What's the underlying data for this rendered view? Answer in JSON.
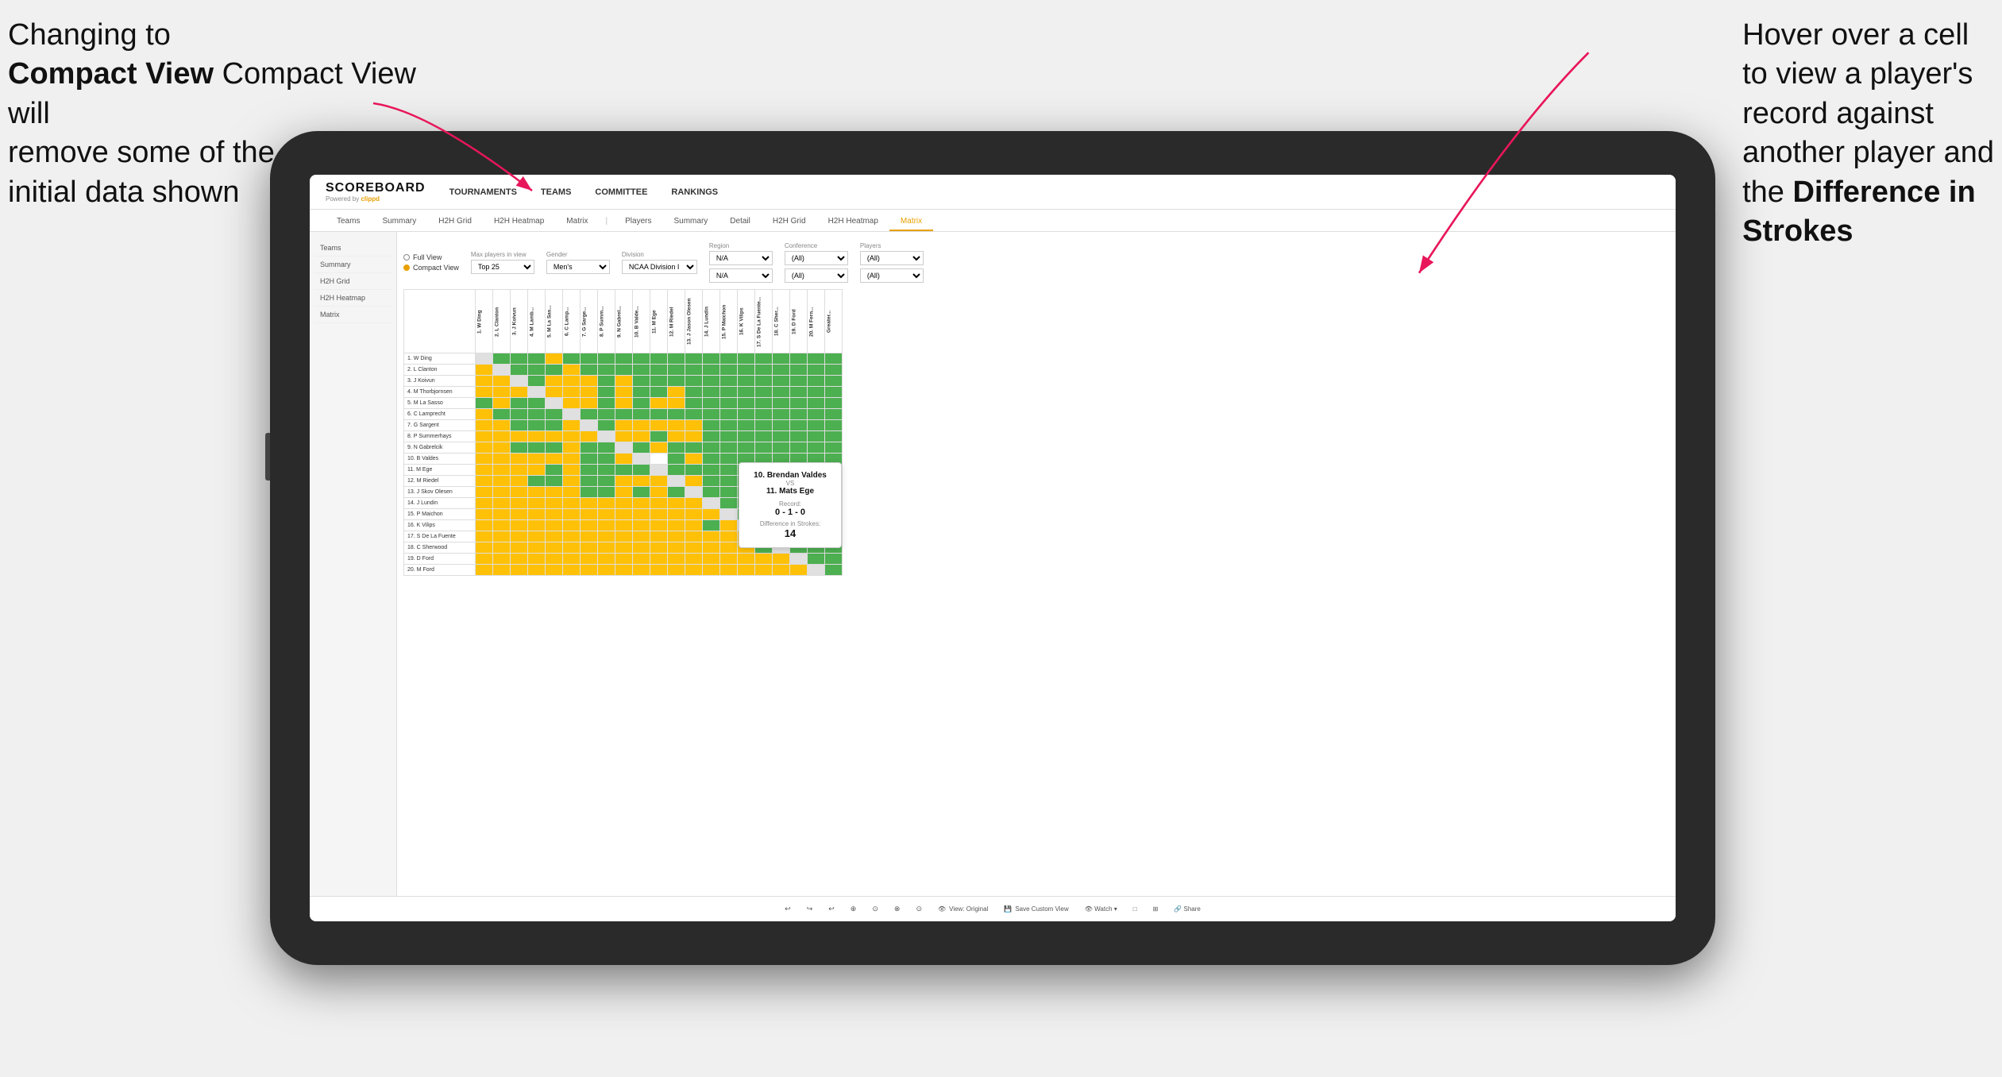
{
  "annotations": {
    "left": {
      "line1": "Changing to",
      "line2": "Compact View will",
      "line3": "remove some of the",
      "line4": "initial data shown"
    },
    "right": {
      "line1": "Hover over a cell",
      "line2": "to view a player's",
      "line3": "record against",
      "line4": "another player and",
      "line5": "the",
      "line6": "Difference in",
      "line7": "Strokes"
    }
  },
  "nav": {
    "logo": "SCOREBOARD",
    "powered_by": "Powered by",
    "clippd": "clippd",
    "links": [
      "TOURNAMENTS",
      "TEAMS",
      "COMMITTEE",
      "RANKINGS"
    ]
  },
  "sub_tabs": [
    "Teams",
    "Summary",
    "H2H Grid",
    "H2H Heatmap",
    "Matrix",
    "Players",
    "Summary",
    "Detail",
    "H2H Grid",
    "H2H Heatmap",
    "Matrix"
  ],
  "active_sub_tab": "Matrix",
  "filters": {
    "view_options": [
      "Full View",
      "Compact View"
    ],
    "selected_view": "Compact View",
    "max_players_label": "Max players in view",
    "max_players_value": "Top 25",
    "gender_label": "Gender",
    "gender_value": "Men's",
    "division_label": "Division",
    "division_value": "NCAA Division I",
    "region_label": "Region",
    "region_value": "N/A",
    "conference_label": "Conference",
    "conference_value": "(All)",
    "players_label": "Players",
    "players_value": "(All)"
  },
  "players": [
    "1. W Ding",
    "2. L Clanton",
    "3. J Koivun",
    "4. M Thorbjornsen",
    "5. M La Sasso",
    "6. C Lamprecht",
    "7. G Sargent",
    "8. P Summerhays",
    "9. N Gabrelcik",
    "10. B Valdes",
    "11. M Ege",
    "12. M Riedel",
    "13. J Skov Olesen",
    "14. J Lundin",
    "15. P Maichon",
    "16. K Vilips",
    "17. S De La Fuente",
    "18. C Sherwood",
    "19. D Ford",
    "20. M Ford"
  ],
  "col_headers": [
    "1. W Ding",
    "2. L Clanton",
    "3. J Koivun",
    "4. M Lamb...",
    "5. M La Sas...",
    "6. C Lamp...",
    "7. G Sarge...",
    "8. P Summ...",
    "9. N Gabrel...",
    "10. B Valde...",
    "11. M Ege",
    "12. M Riedel",
    "13. J Jason Olesen",
    "14. J Lundin",
    "15. P Maichon",
    "16. K Vilips",
    "17. S De La Fuente...",
    "18. C Sher...",
    "19. D Ford",
    "20. M Fern...",
    "Greater..."
  ],
  "tooltip": {
    "player1": "10. Brendan Valdes",
    "vs": "VS",
    "player2": "11. Mats Ege",
    "record_label": "Record:",
    "record": "0 - 1 - 0",
    "diff_label": "Difference in Strokes:",
    "diff": "14"
  },
  "toolbar": {
    "items": [
      "↩",
      "↪",
      "↩",
      "⊕",
      "⊙",
      "⊗",
      "⊙",
      "View: Original",
      "Save Custom View",
      "Watch ▾",
      "□",
      "⊞",
      "Share"
    ]
  },
  "colors": {
    "green": "#4caf50",
    "yellow": "#ffc107",
    "gray": "#bdbdbd",
    "white": "#ffffff",
    "accent": "#e8a000",
    "arrow": "#e8165a"
  }
}
